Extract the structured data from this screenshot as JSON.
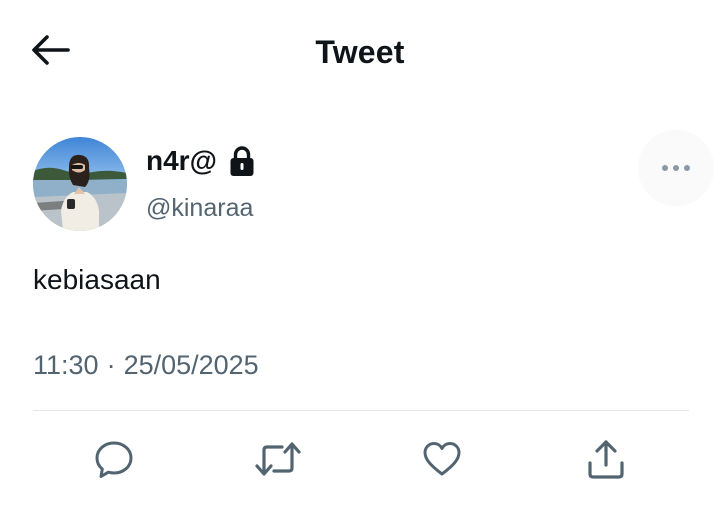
{
  "header": {
    "title": "Tweet",
    "back_icon": "arrow-left-icon"
  },
  "author": {
    "display_name": "n4r@",
    "protected_icon": "lock-icon",
    "handle": "@kinaraa",
    "avatar": "profile-photo"
  },
  "tweet": {
    "text": "kebiasaan",
    "time": "11:30",
    "separator": "·",
    "date": "25/05/2025"
  },
  "more_icon": "more-horizontal-icon",
  "actions": {
    "reply_icon": "reply-icon",
    "retweet_icon": "retweet-icon",
    "like_icon": "heart-icon",
    "share_icon": "share-icon"
  },
  "colors": {
    "text_primary": "#0f1419",
    "text_secondary": "#536471",
    "divider": "#e6e9eb",
    "icon": "#536471"
  }
}
